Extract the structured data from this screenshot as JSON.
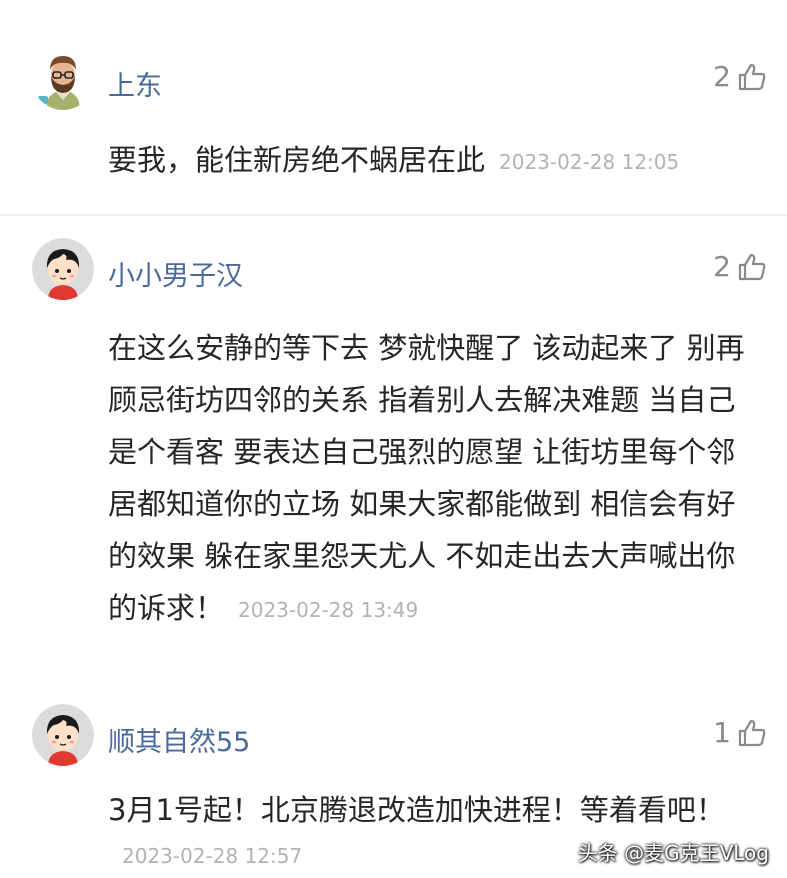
{
  "comments": [
    {
      "username": "上东",
      "likes": "2",
      "text": "要我，能住新房绝不蜗居在此",
      "timestamp": "2023-02-28 12:05"
    },
    {
      "username": "小小男子汉",
      "likes": "2",
      "text": "在这么安静的等下去 梦就快醒了 该动起来了 别再顾忌街坊四邻的关系 指着别人去解决难题 当自己是个看客 要表达自己强烈的愿望 让街坊里每个邻居都知道你的立场 如果大家都能做到 相信会有好的效果 躲在家里怨天尤人 不如走出去大声喊出你的诉求！",
      "timestamp": "2023-02-28 13:49"
    },
    {
      "username": "顺其自然55",
      "likes": "1",
      "text": "3月1号起！北京腾退改造加快进程！等着看吧！",
      "timestamp": "2023-02-28 12:57"
    }
  ],
  "watermark": "头条 @麦G克王VLog",
  "colors": {
    "username": "#4a6a9c",
    "text": "#262626",
    "meta": "#b3b3b3",
    "likes": "#8a8a8a"
  },
  "icons": {
    "like": "thumbs-up-icon",
    "avatar1": "bearded-man-avatar",
    "avatar2": "cartoon-boy-avatar",
    "avatar3": "cartoon-boy-avatar"
  }
}
